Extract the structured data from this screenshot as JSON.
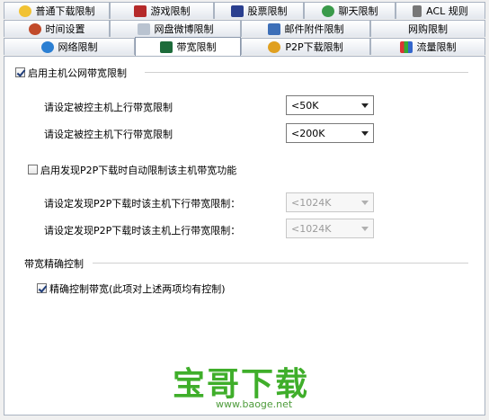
{
  "tabs": {
    "row1": [
      "普通下载限制",
      "游戏限制",
      "股票限制",
      "聊天限制",
      "ACL 规则"
    ],
    "row2": [
      "时间设置",
      "网盘微博限制",
      "邮件附件限制",
      "网购限制"
    ],
    "row3": [
      "网络限制",
      "带宽限制",
      "P2P下载限制",
      "流量限制"
    ],
    "active": "带宽限制"
  },
  "section1": {
    "checkbox_label": "启用主机公网带宽限制",
    "checked": true,
    "upload_label": "请设定被控主机上行带宽限制",
    "upload_value": "<50K",
    "download_label": "请设定被控主机下行带宽限制",
    "download_value": "<200K"
  },
  "section2": {
    "checkbox_label": "启用发现P2P下载时自动限制该主机带宽功能",
    "checked": false,
    "download_label": "请设定发现P2P下载时该主机下行带宽限制：",
    "download_value": "<1024K",
    "upload_label": "请设定发现P2P下载时该主机上行带宽限制：",
    "upload_value": "<1024K"
  },
  "section3": {
    "title": "带宽精确控制",
    "checkbox_label": "精确控制带宽(此项对上述两项均有控制)",
    "checked": true
  },
  "watermark": {
    "text": "宝哥下载",
    "url": "www.baoge.net"
  }
}
